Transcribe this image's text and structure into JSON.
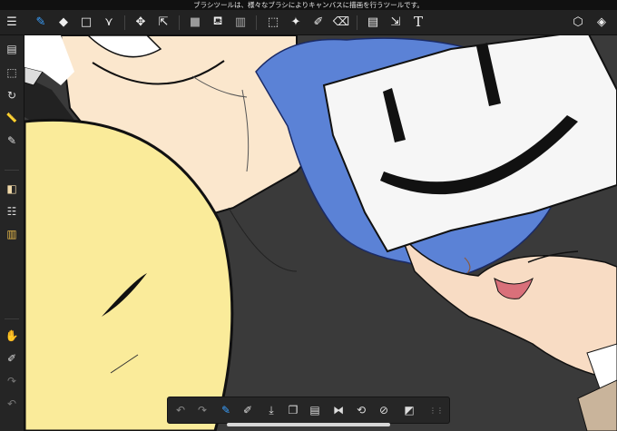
{
  "status_tip": "ブラシツールは、様々なブラシによりキャンバスに描画を行うツールです。",
  "toolbar": {
    "left": [
      {
        "name": "menu-icon",
        "glyph": "☰"
      },
      {
        "name": "brush-icon",
        "glyph": "✎"
      },
      {
        "name": "eraser-icon",
        "glyph": "◆"
      },
      {
        "name": "shape-icon",
        "glyph": "□"
      },
      {
        "name": "vector-icon",
        "glyph": "⋎"
      },
      {
        "name": "move-icon",
        "glyph": "✥"
      },
      {
        "name": "transform-icon",
        "glyph": "⇱"
      },
      {
        "name": "fill-color-icon",
        "glyph": "■"
      },
      {
        "name": "bucket-icon",
        "glyph": "⛾"
      },
      {
        "name": "gradient-icon",
        "glyph": "▥"
      },
      {
        "name": "selection-icon",
        "glyph": "⬚"
      },
      {
        "name": "magic-wand-icon",
        "glyph": "✦"
      },
      {
        "name": "selection-pen-icon",
        "glyph": "✐"
      },
      {
        "name": "selection-eraser-icon",
        "glyph": "⌫"
      },
      {
        "name": "frame-divider-icon",
        "glyph": "▤"
      },
      {
        "name": "text-cursor-icon",
        "glyph": "⇲"
      },
      {
        "name": "text-icon",
        "glyph": "T"
      }
    ],
    "right": [
      {
        "name": "materials-icon",
        "glyph": "⬡"
      },
      {
        "name": "layers-icon",
        "glyph": "◈"
      }
    ]
  },
  "sidebar": {
    "top": [
      {
        "name": "pages-icon",
        "glyph": "▤"
      },
      {
        "name": "selection-area-icon",
        "glyph": "⬚"
      },
      {
        "name": "rotate-icon",
        "glyph": "↻"
      },
      {
        "name": "ruler-icon",
        "glyph": "📏"
      },
      {
        "name": "brush-settings-icon",
        "glyph": "✎"
      },
      {
        "name": "color-swatch-icon",
        "glyph": "◧"
      },
      {
        "name": "tool-property-icon",
        "glyph": "☷"
      },
      {
        "name": "color-set-icon",
        "glyph": "▥"
      }
    ],
    "bottom": [
      {
        "name": "hand-icon",
        "glyph": "✋"
      },
      {
        "name": "eyedropper-icon",
        "glyph": "✐"
      },
      {
        "name": "redo-icon",
        "glyph": "↷"
      },
      {
        "name": "undo-icon",
        "glyph": "↶"
      }
    ]
  },
  "bottom_bar": [
    {
      "name": "undo-icon",
      "glyph": "↶"
    },
    {
      "name": "redo-icon",
      "glyph": "↷"
    },
    {
      "name": "brush-size-icon",
      "glyph": "✎"
    },
    {
      "name": "clear-icon",
      "glyph": "✐"
    },
    {
      "name": "save-icon",
      "glyph": "⤓"
    },
    {
      "name": "copy-icon",
      "glyph": "❐"
    },
    {
      "name": "paste-icon",
      "glyph": "▤"
    },
    {
      "name": "flip-horizontal-icon",
      "glyph": "⧓"
    },
    {
      "name": "rotate-canvas-icon",
      "glyph": "⟲"
    },
    {
      "name": "deselect-icon",
      "glyph": "⊘"
    },
    {
      "name": "invert-selection-icon",
      "glyph": "◩"
    },
    {
      "name": "more-icon",
      "glyph": "⋮⋮"
    }
  ]
}
